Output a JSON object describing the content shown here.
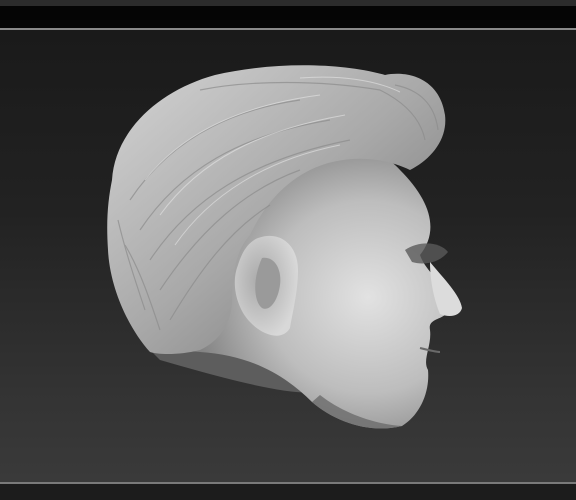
{
  "app": {
    "window": "3d-sculpting-viewport"
  },
  "viewport": {
    "subject": "head-sculpt-model",
    "material_color": "#c8c8c8",
    "background_top": "#1a1a1a",
    "background_bottom": "#3a3a3a"
  },
  "colors": {
    "frame_line": "#8a8a8a",
    "top_bar": "#050505",
    "top_strip": "#2c2c2c",
    "bottom_bar": "#1c1c1c"
  }
}
